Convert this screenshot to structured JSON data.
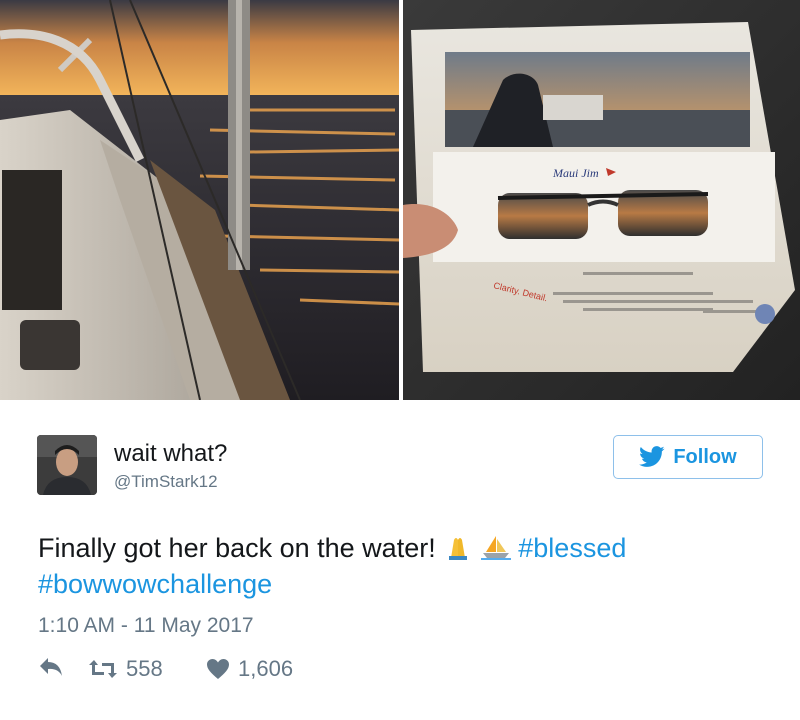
{
  "user": {
    "display_name": "wait what?",
    "handle": "@TimStark12"
  },
  "follow": {
    "label": "Follow",
    "color": "#1b95e0"
  },
  "tweet": {
    "text_main": "Finally got her back on the water!",
    "emojis": [
      "folded-hands-icon",
      "sailboat-icon"
    ],
    "hashtag_blessed": "#blessed",
    "hashtag_bowwow": "#bowwowchallenge",
    "timestamp": "1:10 AM - 11 May 2017"
  },
  "stats": {
    "retweets": "558",
    "likes": "1,606"
  },
  "photos": {
    "right": {
      "brand": "Maui Jim",
      "caption": "Clarity. Detail."
    }
  },
  "colors": {
    "link": "#1b95e0",
    "muted": "#657786",
    "text": "#14171a"
  }
}
